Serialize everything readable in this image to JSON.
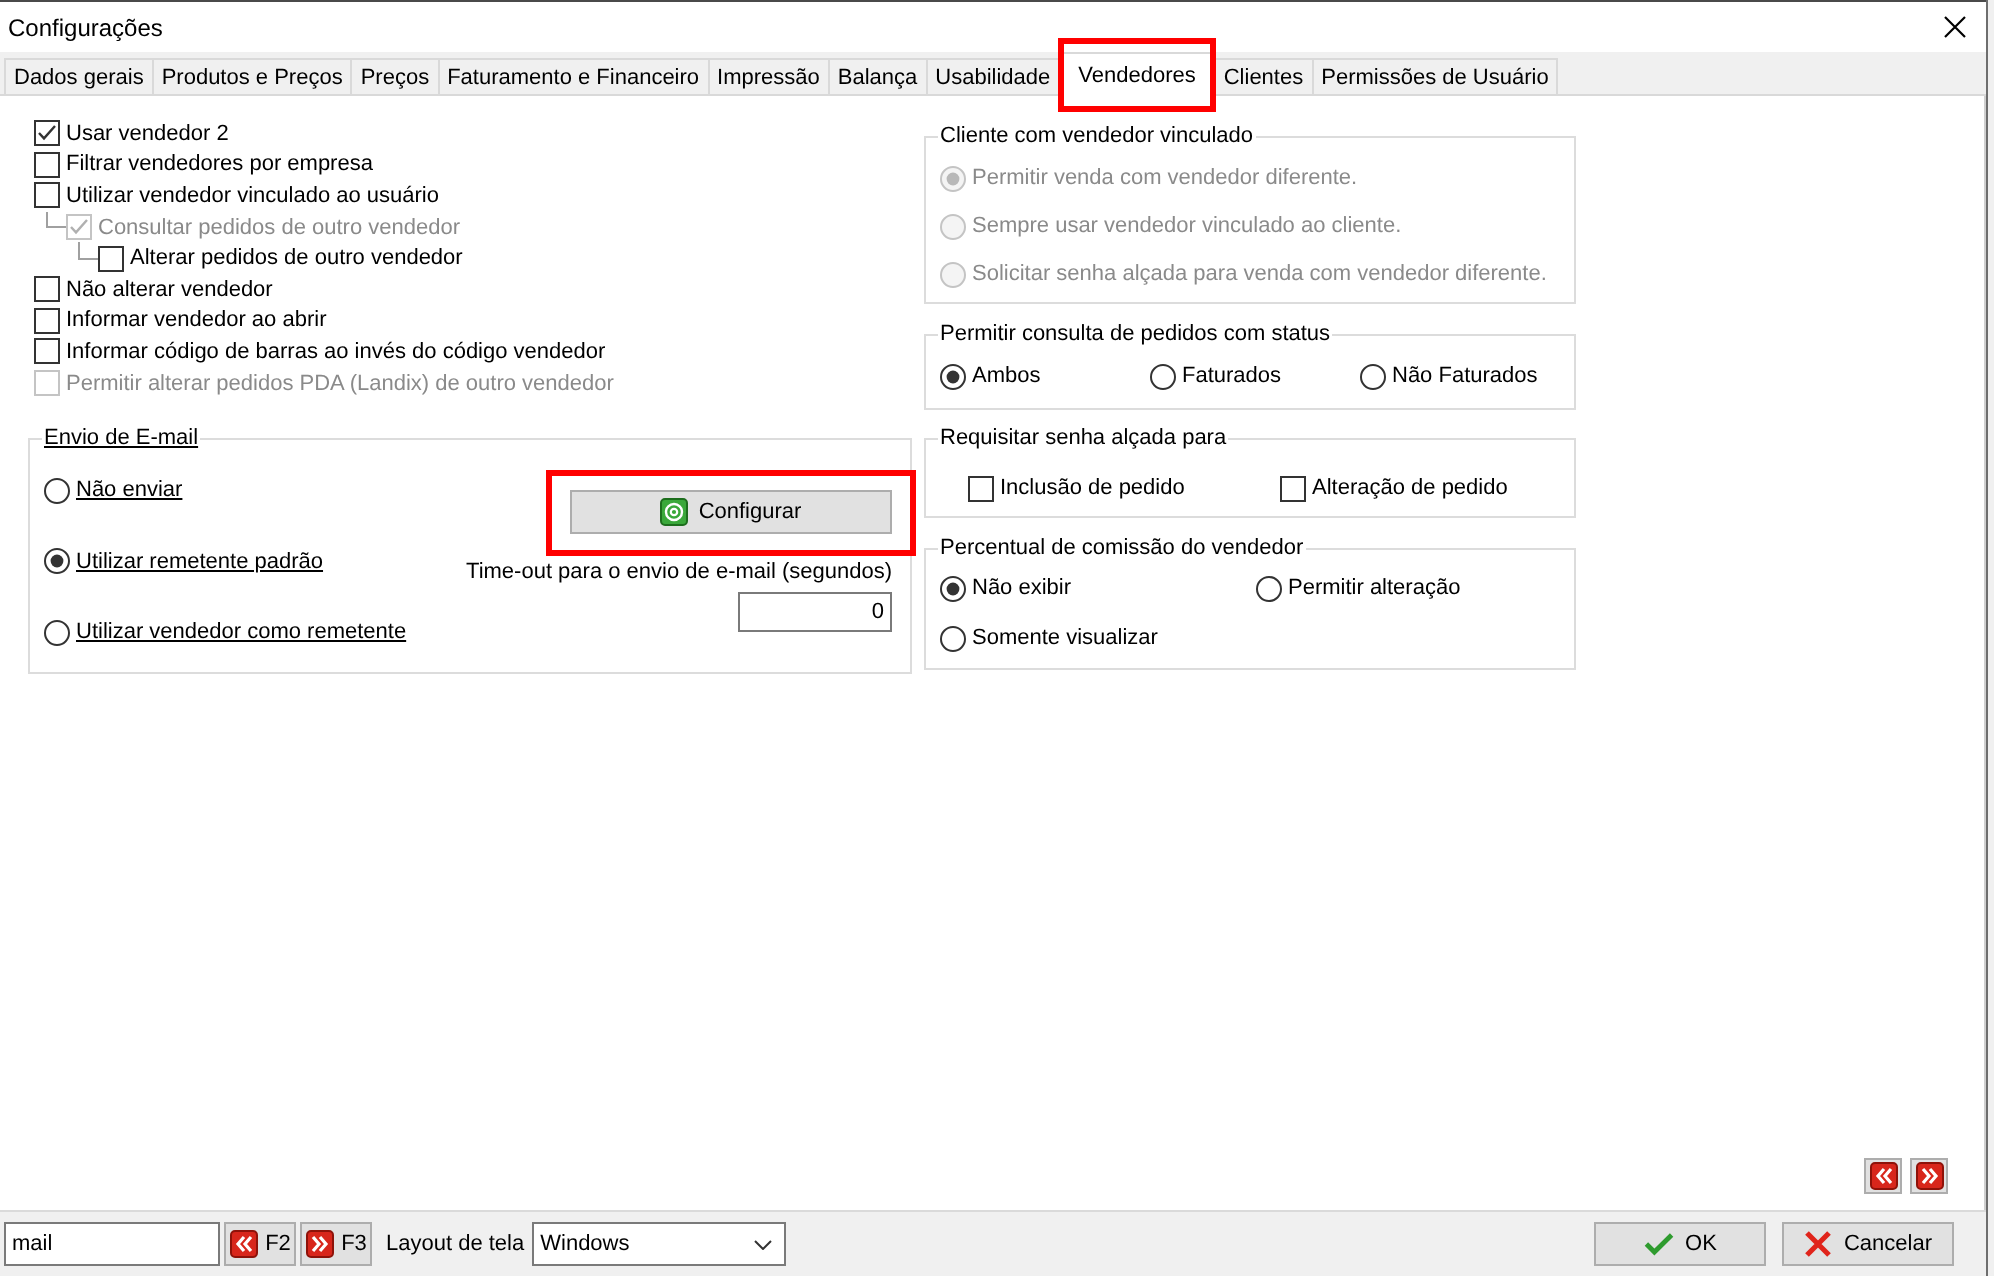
{
  "window": {
    "title": "Configurações"
  },
  "tabs": [
    {
      "label": "Dados gerais",
      "selected": false,
      "highlighted": false
    },
    {
      "label": "Produtos e Preços",
      "selected": false,
      "highlighted": false
    },
    {
      "label": "Preços",
      "selected": false,
      "highlighted": false
    },
    {
      "label": "Faturamento e Financeiro",
      "selected": false,
      "highlighted": false
    },
    {
      "label": "Impressão",
      "selected": false,
      "highlighted": false
    },
    {
      "label": "Balança",
      "selected": false,
      "highlighted": false
    },
    {
      "label": "Usabilidade",
      "selected": false,
      "highlighted": false
    },
    {
      "label": "Vendedores",
      "selected": true,
      "highlighted": true
    },
    {
      "label": "Clientes",
      "selected": false,
      "highlighted": false
    },
    {
      "label": "Permissões de Usuário",
      "selected": false,
      "highlighted": false
    }
  ],
  "options": [
    {
      "label": "Usar vendedor 2",
      "checked": true,
      "disabled": false
    },
    {
      "label": "Filtrar vendedores por empresa",
      "checked": false,
      "disabled": false
    },
    {
      "label": "Utilizar vendedor vinculado ao usuário",
      "checked": false,
      "disabled": false,
      "children": [
        {
          "label": "Consultar pedidos de outro vendedor",
          "checked": true,
          "disabled": true,
          "children": [
            {
              "label": "Alterar pedidos de outro vendedor",
              "checked": false,
              "disabled": false
            }
          ]
        }
      ]
    },
    {
      "label": "Não alterar vendedor",
      "checked": false,
      "disabled": false
    },
    {
      "label": "Informar vendedor ao abrir",
      "checked": false,
      "disabled": false
    },
    {
      "label": "Informar código de barras ao invés do código vendedor",
      "checked": false,
      "disabled": false
    },
    {
      "label": "Permitir alterar pedidos PDA (Landix) de outro vendedor",
      "checked": false,
      "disabled": true
    }
  ],
  "email": {
    "title": "Envio de E-mail",
    "options": [
      {
        "label": "Não enviar",
        "selected": false
      },
      {
        "label": "Utilizar remetente padrão",
        "selected": true
      },
      {
        "label": "Utilizar vendedor como remetente",
        "selected": false
      }
    ],
    "configure_button": {
      "label": "Configurar",
      "highlighted": true
    },
    "timeout": {
      "label": "Time-out para o envio de e-mail (segundos)",
      "value": "0"
    }
  },
  "client_group": {
    "title": "Cliente com vendedor vinculado",
    "options": [
      {
        "label": "Permitir venda com vendedor diferente.",
        "selected": true,
        "disabled": true
      },
      {
        "label": "Sempre usar vendedor vinculado ao cliente.",
        "selected": false,
        "disabled": true
      },
      {
        "label": "Solicitar senha alçada para venda com vendedor diferente.",
        "selected": false,
        "disabled": true
      }
    ]
  },
  "status_group": {
    "title": "Permitir consulta de pedidos com status",
    "options": [
      {
        "label": "Ambos",
        "selected": true
      },
      {
        "label": "Faturados",
        "selected": false
      },
      {
        "label": "Não Faturados",
        "selected": false
      }
    ]
  },
  "password_group": {
    "title": "Requisitar senha alçada para",
    "options": [
      {
        "label": "Inclusão de pedido",
        "checked": false
      },
      {
        "label": "Alteração de pedido",
        "checked": false
      }
    ]
  },
  "commission_group": {
    "title": "Percentual de comissão do vendedor",
    "options": [
      {
        "label": "Não exibir",
        "selected": true
      },
      {
        "label": "Permitir alteração",
        "selected": false
      },
      {
        "label": "Somente visualizar",
        "selected": false
      }
    ]
  },
  "footer": {
    "search": {
      "value": "mail"
    },
    "previous_button": {
      "label": "F2"
    },
    "next_button": {
      "label": "F3"
    },
    "layout": {
      "label": "Layout de tela",
      "value": "Windows"
    },
    "buttons": [
      {
        "label": "OK",
        "kind": "ok"
      },
      {
        "label": "Cancelar",
        "kind": "cancel"
      }
    ]
  }
}
